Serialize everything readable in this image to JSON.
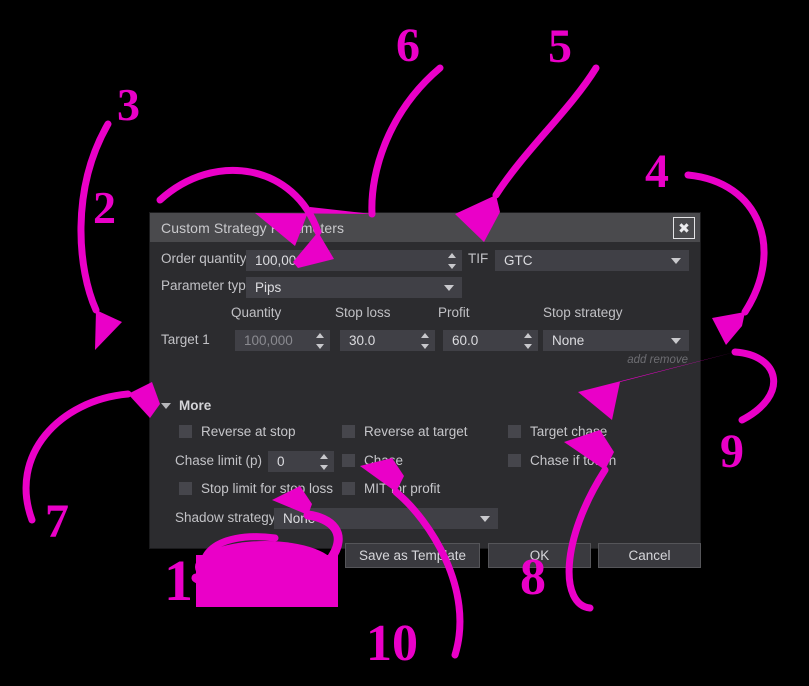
{
  "dialog": {
    "title": "Custom Strategy Parameters",
    "close_icon": "close-x-icon",
    "order_quantity_label": "Order quantity",
    "order_quantity_value": "100,000",
    "tif_label": "TIF",
    "tif_value": "GTC",
    "parameter_type_label": "Parameter type",
    "parameter_type_value": "Pips",
    "columns": {
      "quantity": "Quantity",
      "stop_loss": "Stop loss",
      "profit": "Profit",
      "stop_strategy": "Stop strategy"
    },
    "target_row": {
      "name": "Target 1",
      "quantity": "100,000",
      "stop_loss": "30.0",
      "profit": "60.0",
      "stop_strategy": "None"
    },
    "add_remove": "add  remove",
    "more_label": "More",
    "checkboxes": {
      "reverse_at_stop": "Reverse at stop",
      "reverse_at_target": "Reverse at target",
      "target_chase": "Target chase",
      "chase": "Chase",
      "chase_if_touch": "Chase if touch",
      "stop_limit_for_stop_loss": "Stop limit for stop loss",
      "mit_for_profit": "MIT for profit"
    },
    "chase_limit_label": "Chase limit (p)",
    "chase_limit_value": "0",
    "shadow_strategy_label": "Shadow strategy",
    "shadow_strategy_value": "None",
    "buttons": {
      "save_as_template": "Save as Template",
      "ok": "OK",
      "cancel": "Cancel"
    }
  },
  "annotations": {
    "color": "#ea00c8",
    "markers": [
      {
        "id": "1",
        "label": "1"
      },
      {
        "id": "2",
        "label": "2"
      },
      {
        "id": "3",
        "label": "3"
      },
      {
        "id": "4",
        "label": "4"
      },
      {
        "id": "5",
        "label": "5"
      },
      {
        "id": "6",
        "label": "6"
      },
      {
        "id": "7",
        "label": "7"
      },
      {
        "id": "8",
        "label": "8"
      },
      {
        "id": "9",
        "label": "9"
      },
      {
        "id": "10",
        "label": "10"
      }
    ]
  }
}
